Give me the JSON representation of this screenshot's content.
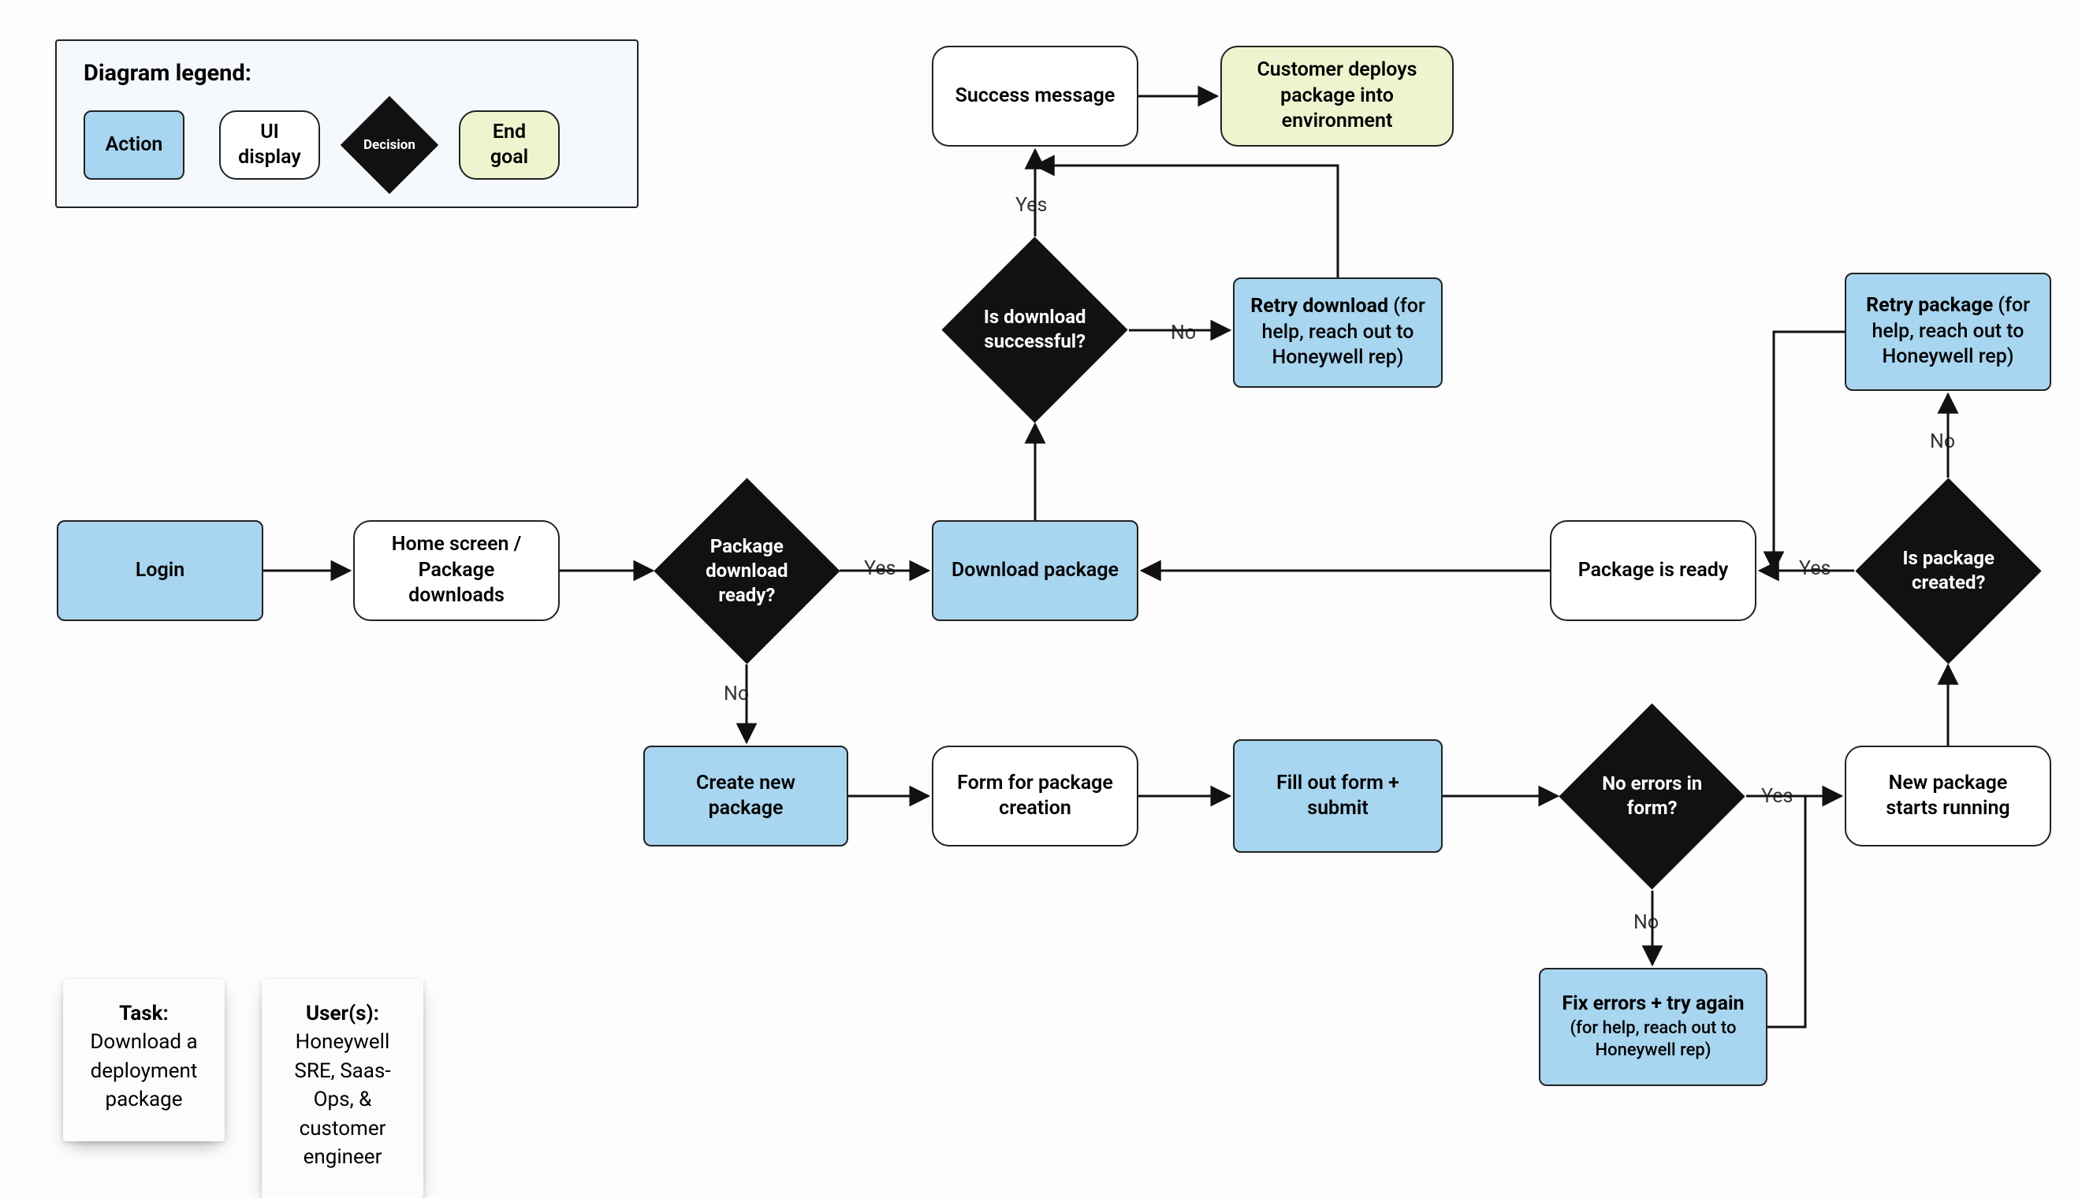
{
  "legend": {
    "title": "Diagram legend:",
    "action": "Action",
    "ui": "UI display",
    "decision": "Decision",
    "goal": "End goal"
  },
  "nodes": {
    "login": "Login",
    "home": "Home screen / Package downloads",
    "q_download_ready": "Package download ready?",
    "download_pkg": "Download package",
    "q_dl_success": "Is download successful?",
    "success_msg": "Success message",
    "deploy": "Customer deploys package into environment",
    "retry_dl_bold": "Retry download",
    "retry_dl_sub": " (for help, reach out to Honeywell rep)",
    "create_pkg": "Create new package",
    "form_creation": "Form for package creation",
    "fill_submit": "Fill out form + submit",
    "q_no_errors": "No errors in form?",
    "fix_errors_bold": "Fix errors + try again",
    "fix_errors_sub": "(for help, reach out to Honeywell rep)",
    "new_pkg_running": "New package starts running",
    "q_pkg_created": "Is package created?",
    "pkg_ready": "Package is ready",
    "retry_pkg_bold": "Retry package",
    "retry_pkg_sub": " (for help, reach out to Honeywell rep)"
  },
  "labels": {
    "yes": "Yes",
    "no": "No"
  },
  "sticky": {
    "task_head_label": "Task",
    "task_body": "Download a deployment package",
    "user_head_label": "User(s)",
    "user_body": "Honeywell SRE, Saas-Ops, & customer engineer"
  }
}
